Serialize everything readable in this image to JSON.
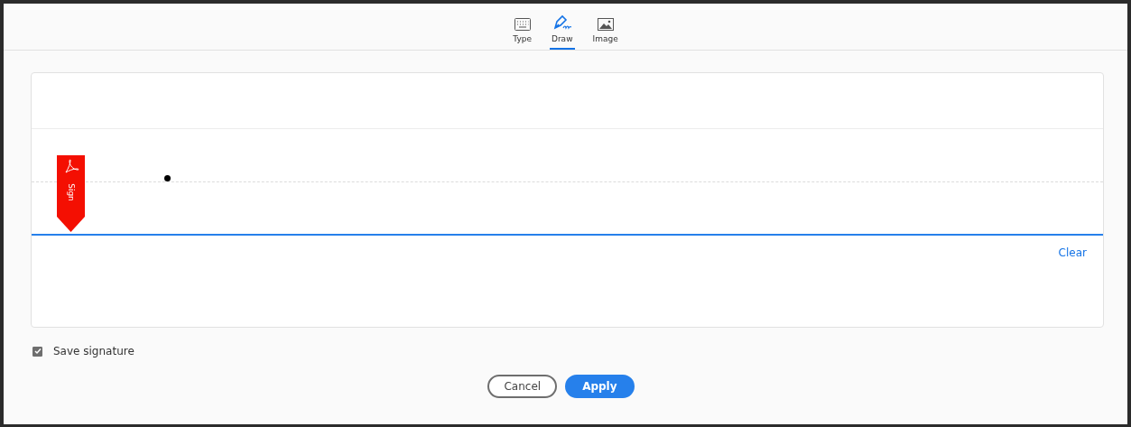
{
  "tabs": [
    {
      "label": "Type",
      "kind": "keyboard",
      "selected": false
    },
    {
      "label": "Draw",
      "kind": "pen",
      "selected": true
    },
    {
      "label": "Image",
      "kind": "image",
      "selected": false
    }
  ],
  "sign_flag": {
    "label": "Sign"
  },
  "clear_link": "Clear",
  "save_signature": {
    "label": "Save signature",
    "checked": true
  },
  "buttons": [
    {
      "label": "Cancel",
      "kind": "secondary"
    },
    {
      "label": "Apply",
      "kind": "primary"
    }
  ]
}
